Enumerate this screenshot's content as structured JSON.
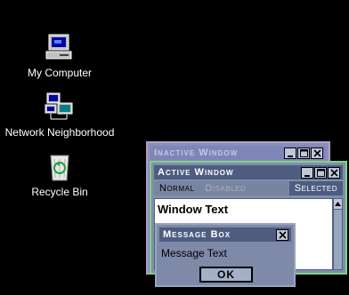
{
  "desktop": {
    "icons": [
      {
        "label": "My Computer",
        "icon": "computer-icon"
      },
      {
        "label": "Network Neighborhood",
        "icon": "network-icon"
      },
      {
        "label": "Recycle Bin",
        "icon": "recycle-bin-icon"
      }
    ]
  },
  "inactive_window": {
    "title": "Inactive Window"
  },
  "active_window": {
    "title": "Active Window",
    "menu": {
      "normal": "Normal",
      "disabled": "Disabled",
      "selected": "Selected"
    },
    "window_text": "Window Text"
  },
  "message_box": {
    "title": "Message Box",
    "text": "Message Text",
    "ok_label": "OK"
  },
  "colors": {
    "desktop": "#000000",
    "active_title": "#4e5c80",
    "inactive_title": "#7e86b8",
    "active_border": "#7fd08a",
    "inactive_border": "#b49cc8"
  }
}
